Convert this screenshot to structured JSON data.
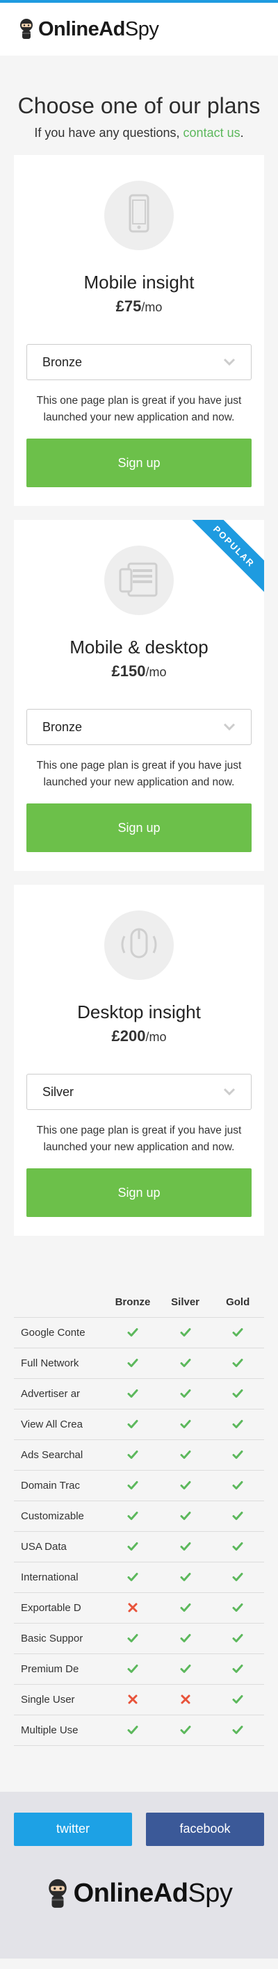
{
  "brand": {
    "name_bold": "OnlineAd",
    "name_light": "Spy"
  },
  "intro": {
    "title": "Choose one of our plans",
    "subtitle_prefix": "If you have any questions,",
    "contact_link": "contact us",
    "subtitle_suffix": "."
  },
  "plans": [
    {
      "name": "Mobile insight",
      "price": "£75",
      "period": "/mo",
      "icon": "mobile-phone-icon",
      "selected_tier": "Bronze",
      "description": "This one page plan is great if you have just launched your new application and now.",
      "button": "Sign up",
      "badge": ""
    },
    {
      "name": "Mobile & desktop",
      "price": "£150",
      "period": "/mo",
      "icon": "mobile-desktop-icon",
      "selected_tier": "Bronze",
      "description": "This one page plan is great if you have just launched your new application and now.",
      "button": "Sign up",
      "badge": "POPULAR"
    },
    {
      "name": "Desktop insight",
      "price": "£200",
      "period": "/mo",
      "icon": "mouse-icon",
      "selected_tier": "Silver",
      "description": "This one page plan is great if you have just launched your new application and now.",
      "button": "Sign up",
      "badge": ""
    }
  ],
  "comparison": {
    "headers": [
      "Bronze",
      "Silver",
      "Gold"
    ],
    "rows": [
      {
        "feature": "Google Conte",
        "bronze": true,
        "silver": true,
        "gold": true
      },
      {
        "feature": "Full Network",
        "bronze": true,
        "silver": true,
        "gold": true
      },
      {
        "feature": "Advertiser ar",
        "bronze": true,
        "silver": true,
        "gold": true
      },
      {
        "feature": "View All Crea",
        "bronze": true,
        "silver": true,
        "gold": true
      },
      {
        "feature": "Ads Searchal",
        "bronze": true,
        "silver": true,
        "gold": true
      },
      {
        "feature": "Domain Trac",
        "bronze": true,
        "silver": true,
        "gold": true
      },
      {
        "feature": "Customizable",
        "bronze": true,
        "silver": true,
        "gold": true
      },
      {
        "feature": "USA Data",
        "bronze": true,
        "silver": true,
        "gold": true
      },
      {
        "feature": "International",
        "bronze": true,
        "silver": true,
        "gold": true
      },
      {
        "feature": "Exportable D",
        "bronze": false,
        "silver": true,
        "gold": true
      },
      {
        "feature": "Basic Suppor",
        "bronze": true,
        "silver": true,
        "gold": true
      },
      {
        "feature": "Premium De",
        "bronze": true,
        "silver": true,
        "gold": true
      },
      {
        "feature": "Single User",
        "bronze": false,
        "silver": false,
        "gold": true
      },
      {
        "feature": "Multiple Use",
        "bronze": true,
        "silver": true,
        "gold": true
      }
    ]
  },
  "footer": {
    "twitter": "twitter",
    "facebook": "facebook"
  },
  "colors": {
    "accent_blue": "#1e9be0",
    "green": "#6cc04a",
    "check_green": "#5cb85c",
    "cross_red": "#e8533a",
    "facebook": "#3b5998",
    "twitter": "#1da1e5"
  }
}
